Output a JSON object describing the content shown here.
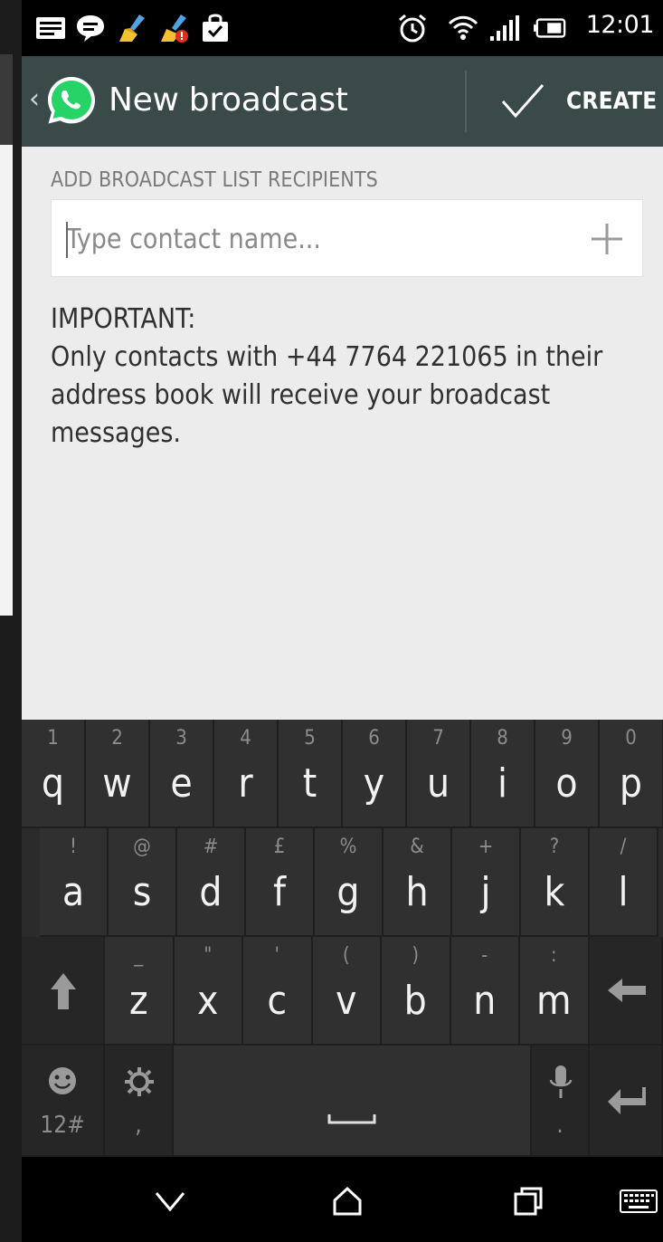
{
  "status_bar": {
    "time": "12:01",
    "icons": [
      "message-icon",
      "chat-bubble-icon",
      "broom-icon",
      "broom-alert-icon",
      "shopping-bag-icon",
      "alarm-icon",
      "wifi-icon",
      "signal-icon",
      "battery-icon"
    ]
  },
  "action_bar": {
    "title": "New broadcast",
    "create_label": "CREATE",
    "colors": {
      "background": "#3a4a48",
      "logo": "#25d366"
    }
  },
  "content": {
    "section_label": "ADD BROADCAST LIST RECIPIENTS",
    "contact_input": {
      "placeholder": "Type contact name...",
      "value": ""
    },
    "notice_title": "IMPORTANT:",
    "notice_body": "Only contacts with +44 7764 221065 in their address book will receive your broadcast messages."
  },
  "keyboard": {
    "row1": [
      {
        "key": "q",
        "hint": "1"
      },
      {
        "key": "w",
        "hint": "2"
      },
      {
        "key": "e",
        "hint": "3"
      },
      {
        "key": "r",
        "hint": "4"
      },
      {
        "key": "t",
        "hint": "5"
      },
      {
        "key": "y",
        "hint": "6"
      },
      {
        "key": "u",
        "hint": "7"
      },
      {
        "key": "i",
        "hint": "8"
      },
      {
        "key": "o",
        "hint": "9"
      },
      {
        "key": "p",
        "hint": "0"
      }
    ],
    "row2": [
      {
        "key": "a",
        "hint": "!"
      },
      {
        "key": "s",
        "hint": "@"
      },
      {
        "key": "d",
        "hint": "#"
      },
      {
        "key": "f",
        "hint": "£"
      },
      {
        "key": "g",
        "hint": "%"
      },
      {
        "key": "h",
        "hint": "&"
      },
      {
        "key": "j",
        "hint": "+"
      },
      {
        "key": "k",
        "hint": "?"
      },
      {
        "key": "l",
        "hint": "/"
      }
    ],
    "row3": [
      {
        "key": "z",
        "hint": "_"
      },
      {
        "key": "x",
        "hint": "\""
      },
      {
        "key": "c",
        "hint": "'"
      },
      {
        "key": "v",
        "hint": "("
      },
      {
        "key": "b",
        "hint": ")"
      },
      {
        "key": "n",
        "hint": "-"
      },
      {
        "key": "m",
        "hint": ":"
      }
    ],
    "symbols_label": "12#",
    "comma_label": ",",
    "period_label": "."
  }
}
